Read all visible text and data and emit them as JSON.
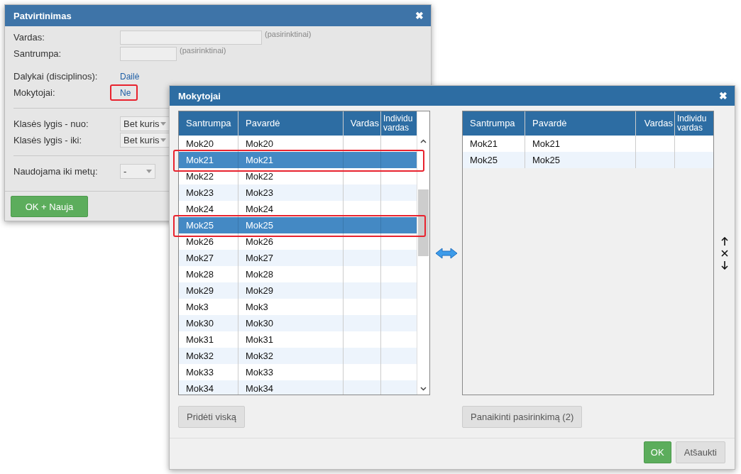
{
  "confirm_dialog": {
    "title": "Patvirtinimas",
    "close": "✖",
    "sections": [
      [
        {
          "kind": "text",
          "label": "Vardas:",
          "hint": "(pasirinktinai)"
        },
        {
          "kind": "text",
          "label": "Santrumpa:",
          "hint": "(pasirinktinai)"
        }
      ],
      [
        {
          "kind": "link",
          "label": "Dalykai (disciplinos):",
          "value": "Dailė",
          "highlighted": false
        },
        {
          "kind": "link",
          "label": "Mokytojai:",
          "value": "Ne",
          "highlighted": true
        }
      ],
      [
        {
          "kind": "select",
          "label": "Klasės lygis - nuo:",
          "value": "Bet kuris"
        },
        {
          "kind": "select",
          "label": "Klasės lygis - iki:",
          "value": "Bet kuris"
        }
      ],
      [
        {
          "kind": "select",
          "label": "Naudojama iki metų:",
          "value": "-"
        }
      ]
    ],
    "button": "OK + Nauja"
  },
  "teachers_dialog": {
    "title": "Mokytojai",
    "close": "✖",
    "available_table": {
      "columns": [
        "Santrumpa",
        "Pavardė",
        "Vardas",
        "Individu vardas"
      ],
      "rows": [
        {
          "santrumpa": "Mok20",
          "pavarde": "Mok20",
          "selected": false
        },
        {
          "santrumpa": "Mok21",
          "pavarde": "Mok21",
          "selected": true
        },
        {
          "santrumpa": "Mok22",
          "pavarde": "Mok22",
          "selected": false
        },
        {
          "santrumpa": "Mok23",
          "pavarde": "Mok23",
          "selected": false
        },
        {
          "santrumpa": "Mok24",
          "pavarde": "Mok24",
          "selected": false
        },
        {
          "santrumpa": "Mok25",
          "pavarde": "Mok25",
          "selected": true
        },
        {
          "santrumpa": "Mok26",
          "pavarde": "Mok26",
          "selected": false
        },
        {
          "santrumpa": "Mok27",
          "pavarde": "Mok27",
          "selected": false
        },
        {
          "santrumpa": "Mok28",
          "pavarde": "Mok28",
          "selected": false
        },
        {
          "santrumpa": "Mok29",
          "pavarde": "Mok29",
          "selected": false
        },
        {
          "santrumpa": "Mok3",
          "pavarde": "Mok3",
          "selected": false
        },
        {
          "santrumpa": "Mok30",
          "pavarde": "Mok30",
          "selected": false
        },
        {
          "santrumpa": "Mok31",
          "pavarde": "Mok31",
          "selected": false
        },
        {
          "santrumpa": "Mok32",
          "pavarde": "Mok32",
          "selected": false
        },
        {
          "santrumpa": "Mok33",
          "pavarde": "Mok33",
          "selected": false
        },
        {
          "santrumpa": "Mok34",
          "pavarde": "Mok34",
          "selected": false
        }
      ]
    },
    "selected_table": {
      "columns": [
        "Santrumpa",
        "Pavardė",
        "Vardas",
        "Individu vardas"
      ],
      "rows": [
        {
          "santrumpa": "Mok21",
          "pavarde": "Mok21",
          "selected": false
        },
        {
          "santrumpa": "Mok25",
          "pavarde": "Mok25",
          "selected": false
        }
      ]
    },
    "add_all_button": "Pridėti viską",
    "clear_button": "Panaikinti pasirinkimą (2)",
    "ok_button": "OK",
    "cancel_button": "Atšaukti"
  }
}
